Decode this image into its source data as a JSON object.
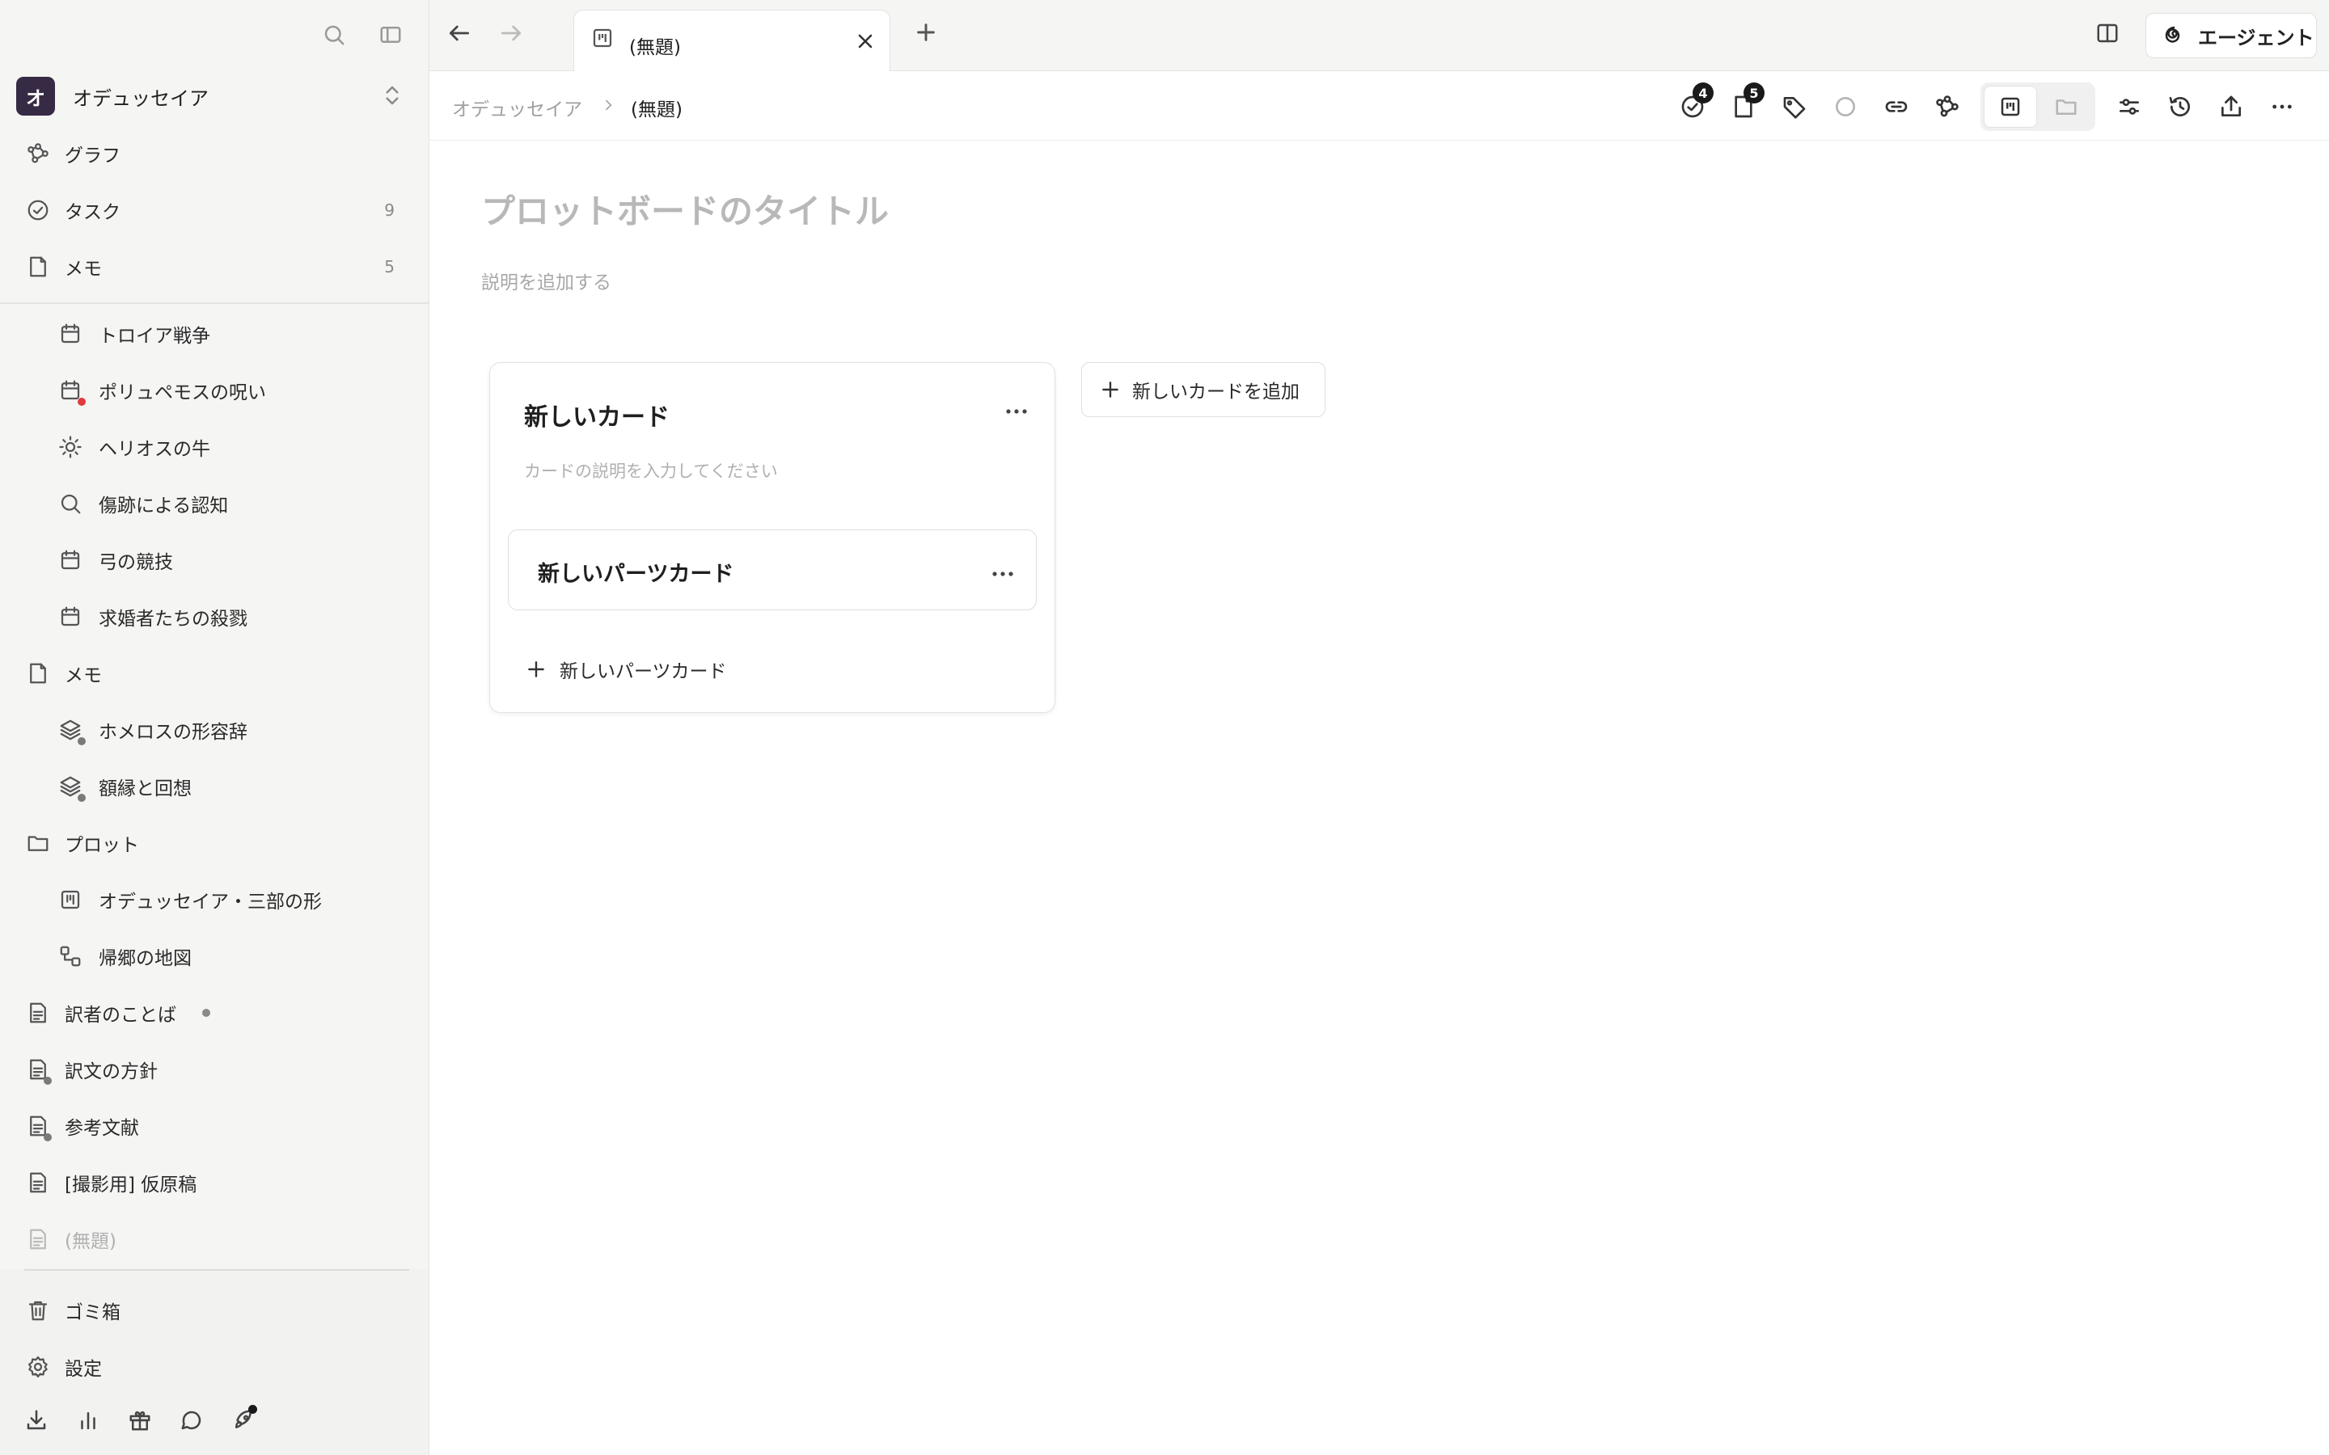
{
  "colors": {
    "accent_avatar": "#362a44",
    "badge_bg": "#1a1a1a",
    "dot_red": "#e03b3b",
    "dot_gray": "#7a7a7a"
  },
  "workspace": {
    "initial": "オ",
    "name": "オデュッセイア"
  },
  "sidebar": {
    "top_nav": [
      {
        "label": "グラフ",
        "icon": "graph-icon"
      },
      {
        "label": "タスク",
        "icon": "task-check-icon",
        "count": "9"
      },
      {
        "label": "メモ",
        "icon": "note-icon",
        "count": "5"
      }
    ],
    "items": [
      {
        "label": "トロイア戦争",
        "icon": "calendar-icon"
      },
      {
        "label": "ポリュペモスの呪い",
        "icon": "calendar-icon"
      },
      {
        "label": "ヘリオスの牛",
        "icon": "sun-icon"
      },
      {
        "label": "傷跡による認知",
        "icon": "search-icon"
      },
      {
        "label": "弓の競技",
        "icon": "calendar-icon"
      },
      {
        "label": "求婚者たちの殺戮",
        "icon": "calendar-icon"
      },
      {
        "label": "メモ",
        "icon": "note-icon"
      },
      {
        "label": "ホメロスの形容辞",
        "icon": "layers-icon"
      },
      {
        "label": "額縁と回想",
        "icon": "layers-icon"
      },
      {
        "label": "プロット",
        "icon": "folder-icon"
      },
      {
        "label": "オデュッセイア・三部の形",
        "icon": "board-icon"
      },
      {
        "label": "帰郷の地図",
        "icon": "map-nodes-icon"
      },
      {
        "label": "訳者のことば",
        "icon": "document-icon"
      },
      {
        "label": "訳文の方針",
        "icon": "document-icon"
      },
      {
        "label": "参考文献",
        "icon": "document-icon"
      },
      {
        "label": "[撮影用] 仮原稿",
        "icon": "document-icon"
      },
      {
        "label": "(無題)",
        "icon": "document-icon"
      }
    ],
    "bottom": [
      {
        "label": "ゴミ箱",
        "icon": "trash-icon"
      },
      {
        "label": "設定",
        "icon": "gear-icon"
      }
    ]
  },
  "tabbar": {
    "tab_title": "(無題)",
    "agent_label": "エージェント"
  },
  "breadcrumb": {
    "parent": "オデュッセイア",
    "current": "(無題)"
  },
  "toolbar": {
    "tasks_badge": "4",
    "notes_badge": "5"
  },
  "board": {
    "title_placeholder": "プロットボードのタイトル",
    "desc_placeholder": "説明を追加する",
    "card": {
      "title": "新しいカード",
      "desc_placeholder": "カードの説明を入力してください",
      "part_title": "新しいパーツカード",
      "add_part_label": "新しいパーツカード"
    },
    "add_card_label": "新しいカードを追加"
  }
}
